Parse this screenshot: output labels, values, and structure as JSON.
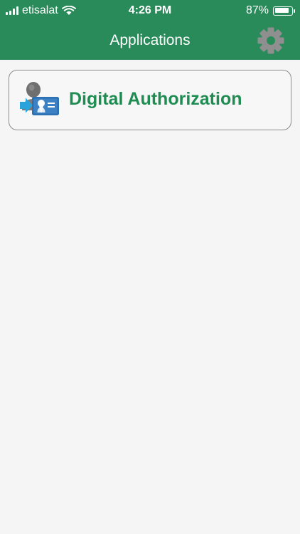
{
  "status_bar": {
    "carrier": "etisalat",
    "time": "4:26 PM",
    "battery_percent_text": "87%",
    "battery_level": 0.87
  },
  "nav": {
    "title": "Applications",
    "settings_icon": "gear-icon"
  },
  "apps": [
    {
      "label": "Digital Authorization",
      "icon": "digital-authorization-icon"
    }
  ],
  "colors": {
    "header_background": "#2a8b5a",
    "accent_green": "#1f8c52",
    "page_background": "#f5f5f5",
    "gear_gray": "#8f8f8f"
  }
}
